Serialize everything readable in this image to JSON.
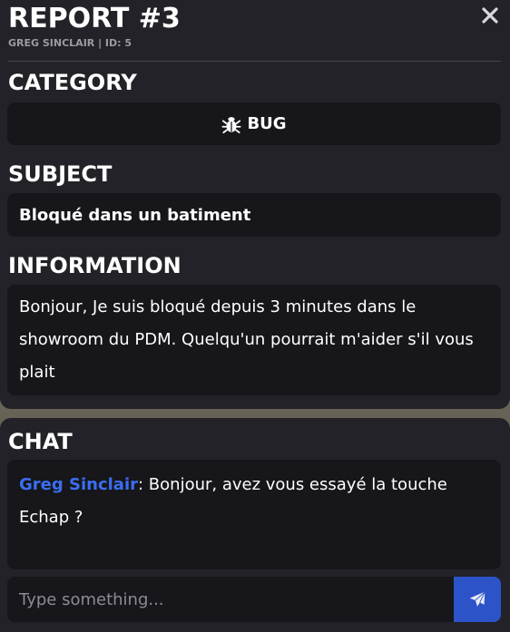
{
  "report": {
    "title": "REPORT #3",
    "subtitle": "GREG SINCLAIR | ID: 5",
    "category_label": "CATEGORY",
    "category_value": "BUG",
    "subject_label": "SUBJECT",
    "subject_value": "Bloqué dans un batiment",
    "information_label": "INFORMATION",
    "information_value": "Bonjour, Je suis bloqué depuis 3 minutes dans le showroom du PDM. Quelqu'un pourrait m'aider s'il vous plait"
  },
  "chat": {
    "label": "CHAT",
    "messages": [
      {
        "author": "Greg Sinclair",
        "separator": ": ",
        "text": "Bonjour, avez vous essayé la touche Echap ?"
      }
    ],
    "input_placeholder": "Type something..."
  },
  "colors": {
    "panel": "#222228",
    "box": "#16161b",
    "author": "#3a6ef0",
    "send_button": "#2c54c8"
  },
  "icons": {
    "close": "close-icon",
    "category": "bug-icon",
    "send": "paper-plane-icon"
  }
}
